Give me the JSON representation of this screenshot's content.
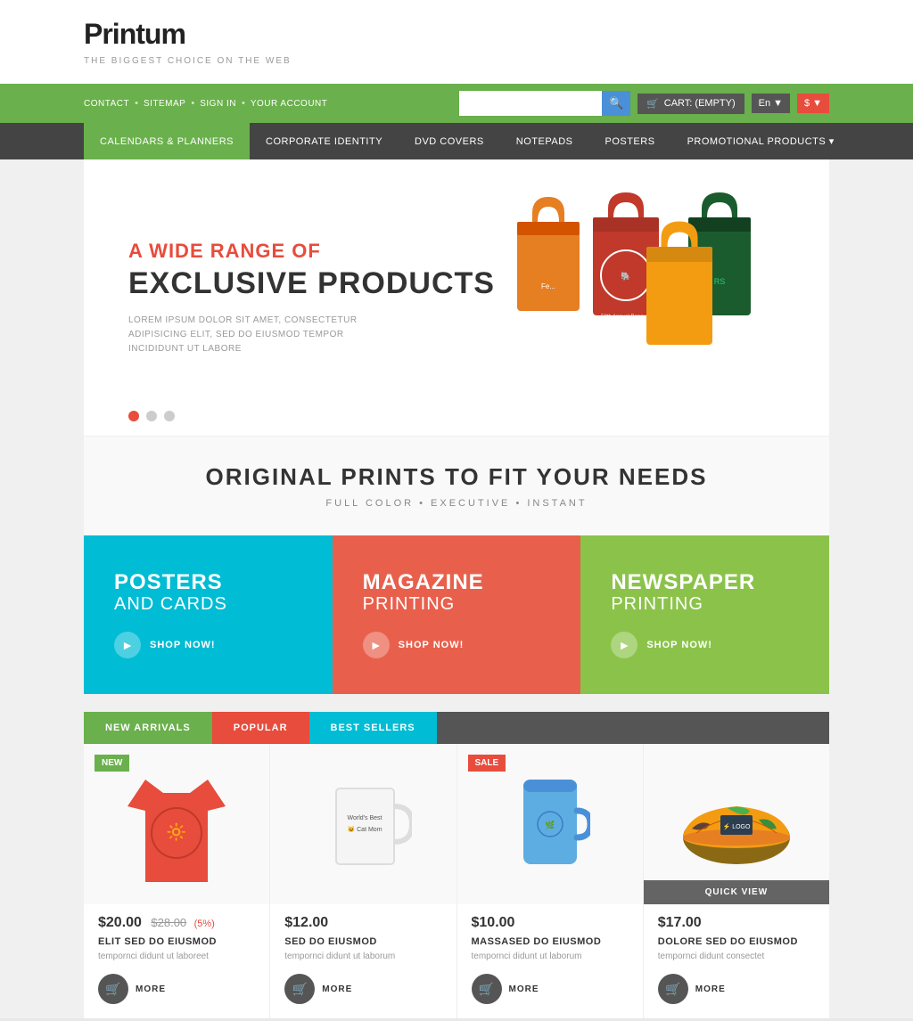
{
  "logo": {
    "name": "Printum",
    "tagline": "THE BIGGEST CHOICE ON THE WEB"
  },
  "topnav": {
    "links": [
      "CONTACT",
      "SITEMAP",
      "SIGN IN",
      "YOUR ACCOUNT"
    ],
    "cart": "CART: (EMPTY)",
    "lang": "En",
    "currency": "$"
  },
  "mainnav": {
    "items": [
      {
        "label": "CALENDARS & PLANNERS",
        "active": true
      },
      {
        "label": "CORPORATE IDENTITY",
        "active": false
      },
      {
        "label": "DVD COVERS",
        "active": false
      },
      {
        "label": "NOTEPADS",
        "active": false
      },
      {
        "label": "POSTERS",
        "active": false
      },
      {
        "label": "PROMOTIONAL PRODUCTS",
        "active": false,
        "hasArrow": true
      }
    ]
  },
  "hero": {
    "subtitle": "A WIDE RANGE OF",
    "title": "EXCLUSIVE PRODUCTS",
    "description": "LOREM IPSUM DOLOR SIT AMET, CONSECTETUR ADIPISICING ELIT, SED DO EIUSMOD TEMPOR INCIDIDUNT UT LABORE"
  },
  "sectionTagline": {
    "heading": "ORIGINAL PRINTS TO FIT YOUR NEEDS",
    "subtext": "FULL COLOR  •  EXECUTIVE  •  INSTANT"
  },
  "categories": [
    {
      "title": "POSTERS",
      "subtitle": "AND CARDS",
      "bgColor": "cyan",
      "shopNow": "SHOP NOW!"
    },
    {
      "title": "MAGAZINE",
      "subtitle": "PRINTING",
      "bgColor": "coral",
      "shopNow": "SHOP NOW!"
    },
    {
      "title": "NEWSPAPER",
      "subtitle": "PRINTING",
      "bgColor": "green",
      "shopNow": "SHOP NOW!"
    }
  ],
  "tabs": [
    {
      "label": "NEW ARRIVALS",
      "state": "active-new"
    },
    {
      "label": "POPULAR",
      "state": "active-pop"
    },
    {
      "label": "BEST SELLERS",
      "state": "active-best"
    }
  ],
  "products": [
    {
      "badge": "NEW",
      "badgeType": "badge-new",
      "price": "$20.00",
      "priceOld": "$28.00",
      "discount": "(5%)",
      "name": "ELIT SED DO EIUSMOD",
      "desc": "tempornci didunt ut laboreet",
      "more": "MORE",
      "hasQuickView": false,
      "bgColor": "#f9f9f9",
      "imageType": "tshirt"
    },
    {
      "badge": "",
      "badgeType": "",
      "price": "$12.00",
      "priceOld": "",
      "discount": "",
      "name": "SED DO EIUSMOD",
      "desc": "tempornci didunt ut laborum",
      "more": "MORE",
      "hasQuickView": false,
      "bgColor": "#f9f9f9",
      "imageType": "mug"
    },
    {
      "badge": "SALE",
      "badgeType": "badge-sale",
      "price": "$10.00",
      "priceOld": "",
      "discount": "",
      "name": "MASSASED DO EIUSMOD",
      "desc": "tempornci didunt ut laborum",
      "more": "MORE",
      "hasQuickView": false,
      "bgColor": "#f9f9f9",
      "imageType": "tumbler"
    },
    {
      "badge": "",
      "badgeType": "",
      "price": "$17.00",
      "priceOld": "",
      "discount": "",
      "name": "DOLORE SED DO EIUSMOD",
      "desc": "tempornci didunt consectet",
      "more": "MORE",
      "hasQuickView": true,
      "bgColor": "#f9f9f9",
      "imageType": "hat"
    }
  ]
}
